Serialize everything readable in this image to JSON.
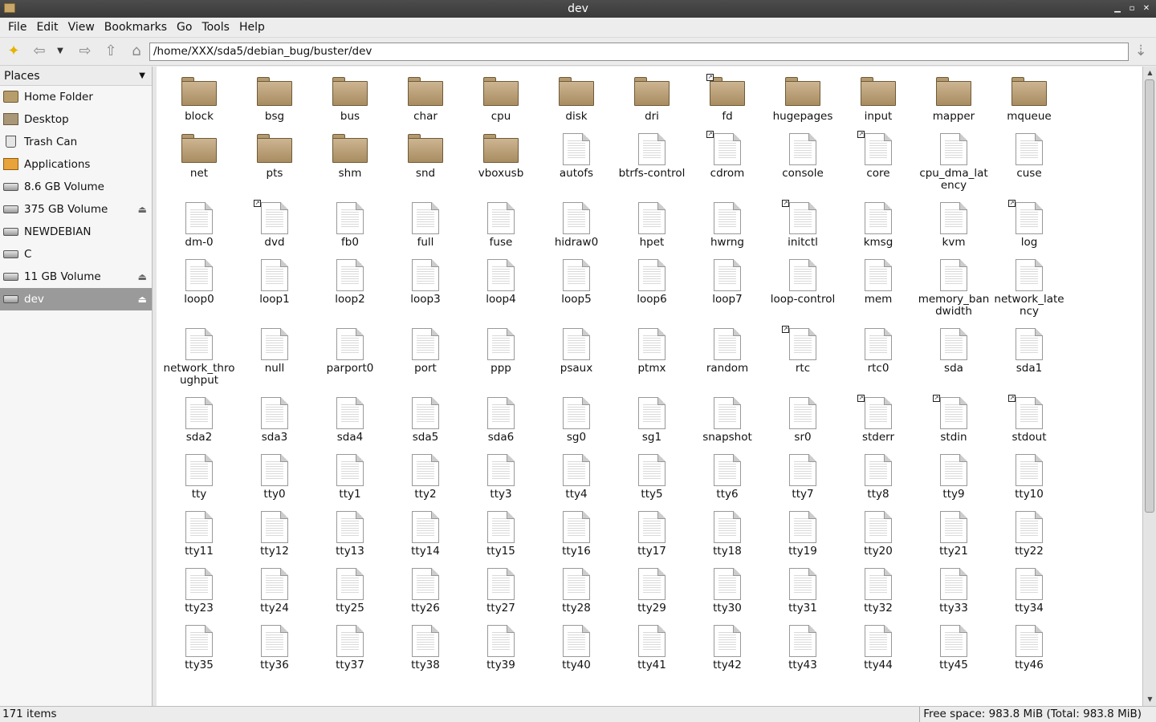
{
  "window": {
    "title": "dev"
  },
  "menubar": [
    "File",
    "Edit",
    "View",
    "Bookmarks",
    "Go",
    "Tools",
    "Help"
  ],
  "toolbar": {
    "location": "/home/XXX/sda5/debian_bug/buster/dev"
  },
  "sidebar": {
    "header": "Places",
    "items": [
      {
        "label": "Home Folder",
        "icon": "home-folder-icon",
        "eject": false,
        "selected": false
      },
      {
        "label": "Desktop",
        "icon": "desktop-icon",
        "eject": false,
        "selected": false
      },
      {
        "label": "Trash Can",
        "icon": "trash-icon",
        "eject": false,
        "selected": false
      },
      {
        "label": "Applications",
        "icon": "applications-icon",
        "eject": false,
        "selected": false
      },
      {
        "label": "8.6 GB Volume",
        "icon": "drive-icon",
        "eject": false,
        "selected": false
      },
      {
        "label": "375 GB Volume",
        "icon": "drive-icon",
        "eject": true,
        "selected": false
      },
      {
        "label": "NEWDEBIAN",
        "icon": "drive-icon",
        "eject": false,
        "selected": false
      },
      {
        "label": "C",
        "icon": "drive-icon",
        "eject": false,
        "selected": false
      },
      {
        "label": "11 GB Volume",
        "icon": "drive-icon",
        "eject": true,
        "selected": false
      },
      {
        "label": "dev",
        "icon": "drive-icon",
        "eject": true,
        "selected": true
      }
    ]
  },
  "files": [
    {
      "name": "block",
      "type": "folder",
      "link": false
    },
    {
      "name": "bsg",
      "type": "folder",
      "link": false
    },
    {
      "name": "bus",
      "type": "folder",
      "link": false
    },
    {
      "name": "char",
      "type": "folder",
      "link": false
    },
    {
      "name": "cpu",
      "type": "folder",
      "link": false
    },
    {
      "name": "disk",
      "type": "folder",
      "link": false
    },
    {
      "name": "dri",
      "type": "folder",
      "link": false
    },
    {
      "name": "fd",
      "type": "folder",
      "link": true
    },
    {
      "name": "hugepages",
      "type": "folder",
      "link": false
    },
    {
      "name": "input",
      "type": "folder",
      "link": false
    },
    {
      "name": "mapper",
      "type": "folder",
      "link": false
    },
    {
      "name": "mqueue",
      "type": "folder",
      "link": false
    },
    {
      "name": "net",
      "type": "folder",
      "link": false
    },
    {
      "name": "pts",
      "type": "folder",
      "link": false
    },
    {
      "name": "shm",
      "type": "folder",
      "link": false
    },
    {
      "name": "snd",
      "type": "folder",
      "link": false
    },
    {
      "name": "vboxusb",
      "type": "folder",
      "link": false
    },
    {
      "name": "autofs",
      "type": "file",
      "link": false
    },
    {
      "name": "btrfs-control",
      "type": "file",
      "link": false
    },
    {
      "name": "cdrom",
      "type": "file",
      "link": true
    },
    {
      "name": "console",
      "type": "file",
      "link": false
    },
    {
      "name": "core",
      "type": "file",
      "link": true
    },
    {
      "name": "cpu_dma_lat\nency",
      "type": "file",
      "link": false
    },
    {
      "name": "cuse",
      "type": "file",
      "link": false
    },
    {
      "name": "dm-0",
      "type": "file",
      "link": false
    },
    {
      "name": "dvd",
      "type": "file",
      "link": true
    },
    {
      "name": "fb0",
      "type": "file",
      "link": false
    },
    {
      "name": "full",
      "type": "file",
      "link": false
    },
    {
      "name": "fuse",
      "type": "file",
      "link": false
    },
    {
      "name": "hidraw0",
      "type": "file",
      "link": false
    },
    {
      "name": "hpet",
      "type": "file",
      "link": false
    },
    {
      "name": "hwrng",
      "type": "file",
      "link": false
    },
    {
      "name": "initctl",
      "type": "file",
      "link": true
    },
    {
      "name": "kmsg",
      "type": "file",
      "link": false
    },
    {
      "name": "kvm",
      "type": "file",
      "link": false
    },
    {
      "name": "log",
      "type": "file",
      "link": true
    },
    {
      "name": "loop0",
      "type": "file",
      "link": false
    },
    {
      "name": "loop1",
      "type": "file",
      "link": false
    },
    {
      "name": "loop2",
      "type": "file",
      "link": false
    },
    {
      "name": "loop3",
      "type": "file",
      "link": false
    },
    {
      "name": "loop4",
      "type": "file",
      "link": false
    },
    {
      "name": "loop5",
      "type": "file",
      "link": false
    },
    {
      "name": "loop6",
      "type": "file",
      "link": false
    },
    {
      "name": "loop7",
      "type": "file",
      "link": false
    },
    {
      "name": "loop-control",
      "type": "file",
      "link": false
    },
    {
      "name": "mem",
      "type": "file",
      "link": false
    },
    {
      "name": "memory_ban\ndwidth",
      "type": "file",
      "link": false
    },
    {
      "name": "network_late\nncy",
      "type": "file",
      "link": false
    },
    {
      "name": "network_thro\nughput",
      "type": "file",
      "link": false
    },
    {
      "name": "null",
      "type": "file",
      "link": false
    },
    {
      "name": "parport0",
      "type": "file",
      "link": false
    },
    {
      "name": "port",
      "type": "file",
      "link": false
    },
    {
      "name": "ppp",
      "type": "file",
      "link": false
    },
    {
      "name": "psaux",
      "type": "file",
      "link": false
    },
    {
      "name": "ptmx",
      "type": "file",
      "link": false
    },
    {
      "name": "random",
      "type": "file",
      "link": false
    },
    {
      "name": "rtc",
      "type": "file",
      "link": true
    },
    {
      "name": "rtc0",
      "type": "file",
      "link": false
    },
    {
      "name": "sda",
      "type": "file",
      "link": false
    },
    {
      "name": "sda1",
      "type": "file",
      "link": false
    },
    {
      "name": "sda2",
      "type": "file",
      "link": false
    },
    {
      "name": "sda3",
      "type": "file",
      "link": false
    },
    {
      "name": "sda4",
      "type": "file",
      "link": false
    },
    {
      "name": "sda5",
      "type": "file",
      "link": false
    },
    {
      "name": "sda6",
      "type": "file",
      "link": false
    },
    {
      "name": "sg0",
      "type": "file",
      "link": false
    },
    {
      "name": "sg1",
      "type": "file",
      "link": false
    },
    {
      "name": "snapshot",
      "type": "file",
      "link": false
    },
    {
      "name": "sr0",
      "type": "file",
      "link": false
    },
    {
      "name": "stderr",
      "type": "file",
      "link": true
    },
    {
      "name": "stdin",
      "type": "file",
      "link": true
    },
    {
      "name": "stdout",
      "type": "file",
      "link": true
    },
    {
      "name": "tty",
      "type": "file",
      "link": false
    },
    {
      "name": "tty0",
      "type": "file",
      "link": false
    },
    {
      "name": "tty1",
      "type": "file",
      "link": false
    },
    {
      "name": "tty2",
      "type": "file",
      "link": false
    },
    {
      "name": "tty3",
      "type": "file",
      "link": false
    },
    {
      "name": "tty4",
      "type": "file",
      "link": false
    },
    {
      "name": "tty5",
      "type": "file",
      "link": false
    },
    {
      "name": "tty6",
      "type": "file",
      "link": false
    },
    {
      "name": "tty7",
      "type": "file",
      "link": false
    },
    {
      "name": "tty8",
      "type": "file",
      "link": false
    },
    {
      "name": "tty9",
      "type": "file",
      "link": false
    },
    {
      "name": "tty10",
      "type": "file",
      "link": false
    },
    {
      "name": "tty11",
      "type": "file",
      "link": false
    },
    {
      "name": "tty12",
      "type": "file",
      "link": false
    },
    {
      "name": "tty13",
      "type": "file",
      "link": false
    },
    {
      "name": "tty14",
      "type": "file",
      "link": false
    },
    {
      "name": "tty15",
      "type": "file",
      "link": false
    },
    {
      "name": "tty16",
      "type": "file",
      "link": false
    },
    {
      "name": "tty17",
      "type": "file",
      "link": false
    },
    {
      "name": "tty18",
      "type": "file",
      "link": false
    },
    {
      "name": "tty19",
      "type": "file",
      "link": false
    },
    {
      "name": "tty20",
      "type": "file",
      "link": false
    },
    {
      "name": "tty21",
      "type": "file",
      "link": false
    },
    {
      "name": "tty22",
      "type": "file",
      "link": false
    },
    {
      "name": "tty23",
      "type": "file",
      "link": false
    },
    {
      "name": "tty24",
      "type": "file",
      "link": false
    },
    {
      "name": "tty25",
      "type": "file",
      "link": false
    },
    {
      "name": "tty26",
      "type": "file",
      "link": false
    },
    {
      "name": "tty27",
      "type": "file",
      "link": false
    },
    {
      "name": "tty28",
      "type": "file",
      "link": false
    },
    {
      "name": "tty29",
      "type": "file",
      "link": false
    },
    {
      "name": "tty30",
      "type": "file",
      "link": false
    },
    {
      "name": "tty31",
      "type": "file",
      "link": false
    },
    {
      "name": "tty32",
      "type": "file",
      "link": false
    },
    {
      "name": "tty33",
      "type": "file",
      "link": false
    },
    {
      "name": "tty34",
      "type": "file",
      "link": false
    },
    {
      "name": "tty35",
      "type": "file",
      "link": false
    },
    {
      "name": "tty36",
      "type": "file",
      "link": false
    },
    {
      "name": "tty37",
      "type": "file",
      "link": false
    },
    {
      "name": "tty38",
      "type": "file",
      "link": false
    },
    {
      "name": "tty39",
      "type": "file",
      "link": false
    },
    {
      "name": "tty40",
      "type": "file",
      "link": false
    },
    {
      "name": "tty41",
      "type": "file",
      "link": false
    },
    {
      "name": "tty42",
      "type": "file",
      "link": false
    },
    {
      "name": "tty43",
      "type": "file",
      "link": false
    },
    {
      "name": "tty44",
      "type": "file",
      "link": false
    },
    {
      "name": "tty45",
      "type": "file",
      "link": false
    },
    {
      "name": "tty46",
      "type": "file",
      "link": false
    }
  ],
  "statusbar": {
    "items": "171 items",
    "free_space": "Free space: 983.8 MiB (Total: 983.8 MiB)"
  }
}
